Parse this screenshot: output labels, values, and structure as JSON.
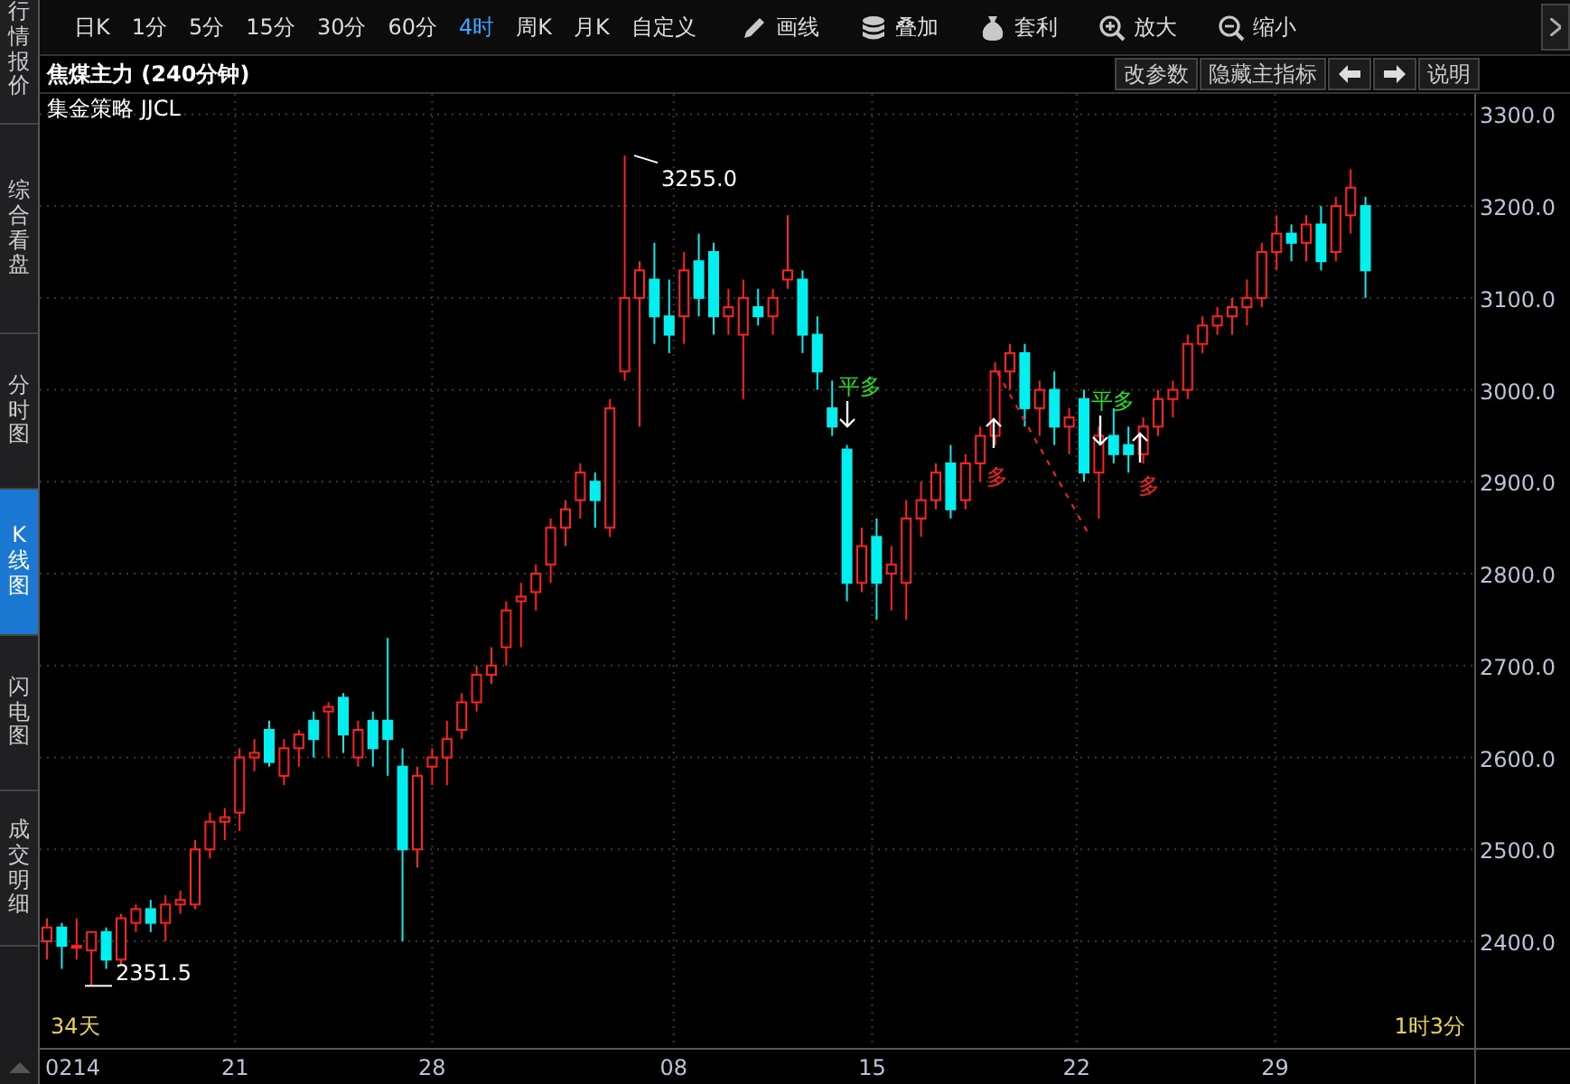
{
  "sidebar": {
    "tabs": [
      {
        "label": "行情报价",
        "selected": false
      },
      {
        "label": "综合看盘",
        "selected": false
      },
      {
        "label": "分时图",
        "selected": false
      },
      {
        "label": "K线图",
        "selected": true
      },
      {
        "label": "闪电图",
        "selected": false
      },
      {
        "label": "成交明细",
        "selected": false
      }
    ]
  },
  "toolbar": {
    "periods": [
      {
        "label": "日K",
        "selected": false
      },
      {
        "label": "1分",
        "selected": false
      },
      {
        "label": "5分",
        "selected": false
      },
      {
        "label": "15分",
        "selected": false
      },
      {
        "label": "30分",
        "selected": false
      },
      {
        "label": "60分",
        "selected": false
      },
      {
        "label": "4时",
        "selected": true
      },
      {
        "label": "周K",
        "selected": false
      },
      {
        "label": "月K",
        "selected": false
      },
      {
        "label": "自定义",
        "selected": false
      }
    ],
    "tools": [
      {
        "kind": "pencil",
        "label": "画线"
      },
      {
        "kind": "stack",
        "label": "叠加"
      },
      {
        "kind": "bag",
        "label": "套利"
      },
      {
        "kind": "zoom-in",
        "label": "放大"
      },
      {
        "kind": "zoom-out",
        "label": "缩小"
      }
    ]
  },
  "chart": {
    "title": "焦煤主力 (240分钟)",
    "subtitle": "集金策略 JJCL",
    "buttons": [
      {
        "kind": "text",
        "label": "改参数"
      },
      {
        "kind": "text",
        "label": "隐藏主指标"
      },
      {
        "kind": "left"
      },
      {
        "kind": "right"
      },
      {
        "kind": "text",
        "label": "说明"
      }
    ],
    "chart_data": {
      "type": "candlestick",
      "ylim": [
        2284,
        3322
      ],
      "yticks": [
        {
          "value": 3300,
          "label": "3300.0"
        },
        {
          "value": 3200,
          "label": "3200.0"
        },
        {
          "value": 3100,
          "label": "3100.0"
        },
        {
          "value": 3000,
          "label": "3000.0"
        },
        {
          "value": 2900,
          "label": "2900.0"
        },
        {
          "value": 2800,
          "label": "2800.0"
        },
        {
          "value": 2700,
          "label": "2700.0"
        },
        {
          "value": 2600,
          "label": "2600.0"
        },
        {
          "value": 2500,
          "label": "2500.0"
        },
        {
          "value": 2400,
          "label": "2400.0"
        }
      ],
      "grid": true,
      "ohlc": [
        [
          2400,
          2425,
          2380,
          2415
        ],
        [
          2415,
          2420,
          2370,
          2395
        ],
        [
          2395,
          2425,
          2380,
          2395
        ],
        [
          2390,
          2410,
          2351.5,
          2410
        ],
        [
          2410,
          2415,
          2370,
          2380
        ],
        [
          2380,
          2430,
          2375,
          2425
        ],
        [
          2420,
          2440,
          2410,
          2435
        ],
        [
          2435,
          2445,
          2410,
          2420
        ],
        [
          2420,
          2450,
          2400,
          2440
        ],
        [
          2440,
          2455,
          2430,
          2445
        ],
        [
          2440,
          2510,
          2435,
          2500
        ],
        [
          2500,
          2540,
          2490,
          2530
        ],
        [
          2530,
          2545,
          2510,
          2535
        ],
        [
          2540,
          2610,
          2520,
          2600
        ],
        [
          2600,
          2620,
          2585,
          2605
        ],
        [
          2630,
          2640,
          2590,
          2595
        ],
        [
          2580,
          2620,
          2570,
          2610
        ],
        [
          2610,
          2630,
          2590,
          2625
        ],
        [
          2640,
          2650,
          2600,
          2620
        ],
        [
          2650,
          2660,
          2600,
          2655
        ],
        [
          2665,
          2670,
          2605,
          2625
        ],
        [
          2600,
          2640,
          2590,
          2630
        ],
        [
          2640,
          2650,
          2590,
          2610
        ],
        [
          2640,
          2730,
          2580,
          2620
        ],
        [
          2590,
          2610,
          2400,
          2500
        ],
        [
          2500,
          2590,
          2480,
          2580
        ],
        [
          2590,
          2610,
          2570,
          2600
        ],
        [
          2600,
          2640,
          2570,
          2620
        ],
        [
          2630,
          2670,
          2620,
          2660
        ],
        [
          2660,
          2700,
          2650,
          2690
        ],
        [
          2690,
          2720,
          2680,
          2700
        ],
        [
          2720,
          2770,
          2700,
          2760
        ],
        [
          2770,
          2790,
          2720,
          2775
        ],
        [
          2780,
          2810,
          2760,
          2800
        ],
        [
          2810,
          2860,
          2790,
          2850
        ],
        [
          2850,
          2880,
          2830,
          2870
        ],
        [
          2880,
          2920,
          2860,
          2910
        ],
        [
          2900,
          2910,
          2850,
          2880
        ],
        [
          2850,
          2990,
          2840,
          2980
        ],
        [
          3020,
          3255,
          3010,
          3100
        ],
        [
          3100,
          3140,
          2960,
          3130
        ],
        [
          3120,
          3160,
          3050,
          3080
        ],
        [
          3080,
          3120,
          3040,
          3060
        ],
        [
          3080,
          3150,
          3050,
          3130
        ],
        [
          3140,
          3170,
          3080,
          3100
        ],
        [
          3150,
          3160,
          3060,
          3080
        ],
        [
          3080,
          3110,
          3060,
          3090
        ],
        [
          3060,
          3120,
          2990,
          3100
        ],
        [
          3090,
          3110,
          3070,
          3080
        ],
        [
          3080,
          3110,
          3060,
          3100
        ],
        [
          3120,
          3190,
          3110,
          3130
        ],
        [
          3120,
          3130,
          3040,
          3060
        ],
        [
          3060,
          3080,
          3000,
          3020
        ],
        [
          2980,
          3010,
          2950,
          2960
        ],
        [
          2935,
          2940,
          2770,
          2790
        ],
        [
          2790,
          2850,
          2780,
          2830
        ],
        [
          2840,
          2860,
          2750,
          2790
        ],
        [
          2800,
          2830,
          2760,
          2810
        ],
        [
          2790,
          2880,
          2750,
          2860
        ],
        [
          2860,
          2900,
          2840,
          2880
        ],
        [
          2880,
          2920,
          2870,
          2910
        ],
        [
          2920,
          2940,
          2860,
          2870
        ],
        [
          2880,
          2930,
          2870,
          2920
        ],
        [
          2920,
          2960,
          2900,
          2950
        ],
        [
          2950,
          3030,
          2940,
          3020
        ],
        [
          3020,
          3050,
          3000,
          3040
        ],
        [
          3040,
          3050,
          2960,
          2980
        ],
        [
          2980,
          3010,
          2950,
          3000
        ],
        [
          3000,
          3020,
          2940,
          2960
        ],
        [
          2960,
          2980,
          2930,
          2970
        ],
        [
          2990,
          3000,
          2900,
          2910
        ],
        [
          2910,
          2960,
          2860,
          2950
        ],
        [
          2950,
          2980,
          2920,
          2930
        ],
        [
          2940,
          2960,
          2910,
          2930
        ],
        [
          2930,
          2970,
          2920,
          2960
        ],
        [
          2960,
          3000,
          2950,
          2990
        ],
        [
          2990,
          3010,
          2970,
          3000
        ],
        [
          3000,
          3060,
          2990,
          3050
        ],
        [
          3050,
          3080,
          3040,
          3070
        ],
        [
          3070,
          3090,
          3060,
          3080
        ],
        [
          3080,
          3100,
          3060,
          3090
        ],
        [
          3090,
          3120,
          3070,
          3100
        ],
        [
          3100,
          3160,
          3090,
          3150
        ],
        [
          3150,
          3190,
          3130,
          3170
        ],
        [
          3170,
          3180,
          3140,
          3160
        ],
        [
          3160,
          3190,
          3140,
          3180
        ],
        [
          3180,
          3200,
          3130,
          3140
        ],
        [
          3150,
          3210,
          3140,
          3200
        ],
        [
          3190,
          3240,
          3170,
          3220
        ],
        [
          3200,
          3210,
          3100,
          3130
        ]
      ]
    },
    "date_labels": [
      "0214",
      "21",
      "28",
      "08",
      "15",
      "22",
      "29"
    ],
    "high_label": "3255.0",
    "low_label": "2351.5",
    "signals": [
      {
        "kind": "close",
        "label": "平多"
      },
      {
        "kind": "open",
        "label": "多"
      },
      {
        "kind": "close",
        "label": "平多"
      },
      {
        "kind": "open",
        "label": "多"
      }
    ],
    "left_footer": "34天",
    "right_footer": "1时3分"
  }
}
